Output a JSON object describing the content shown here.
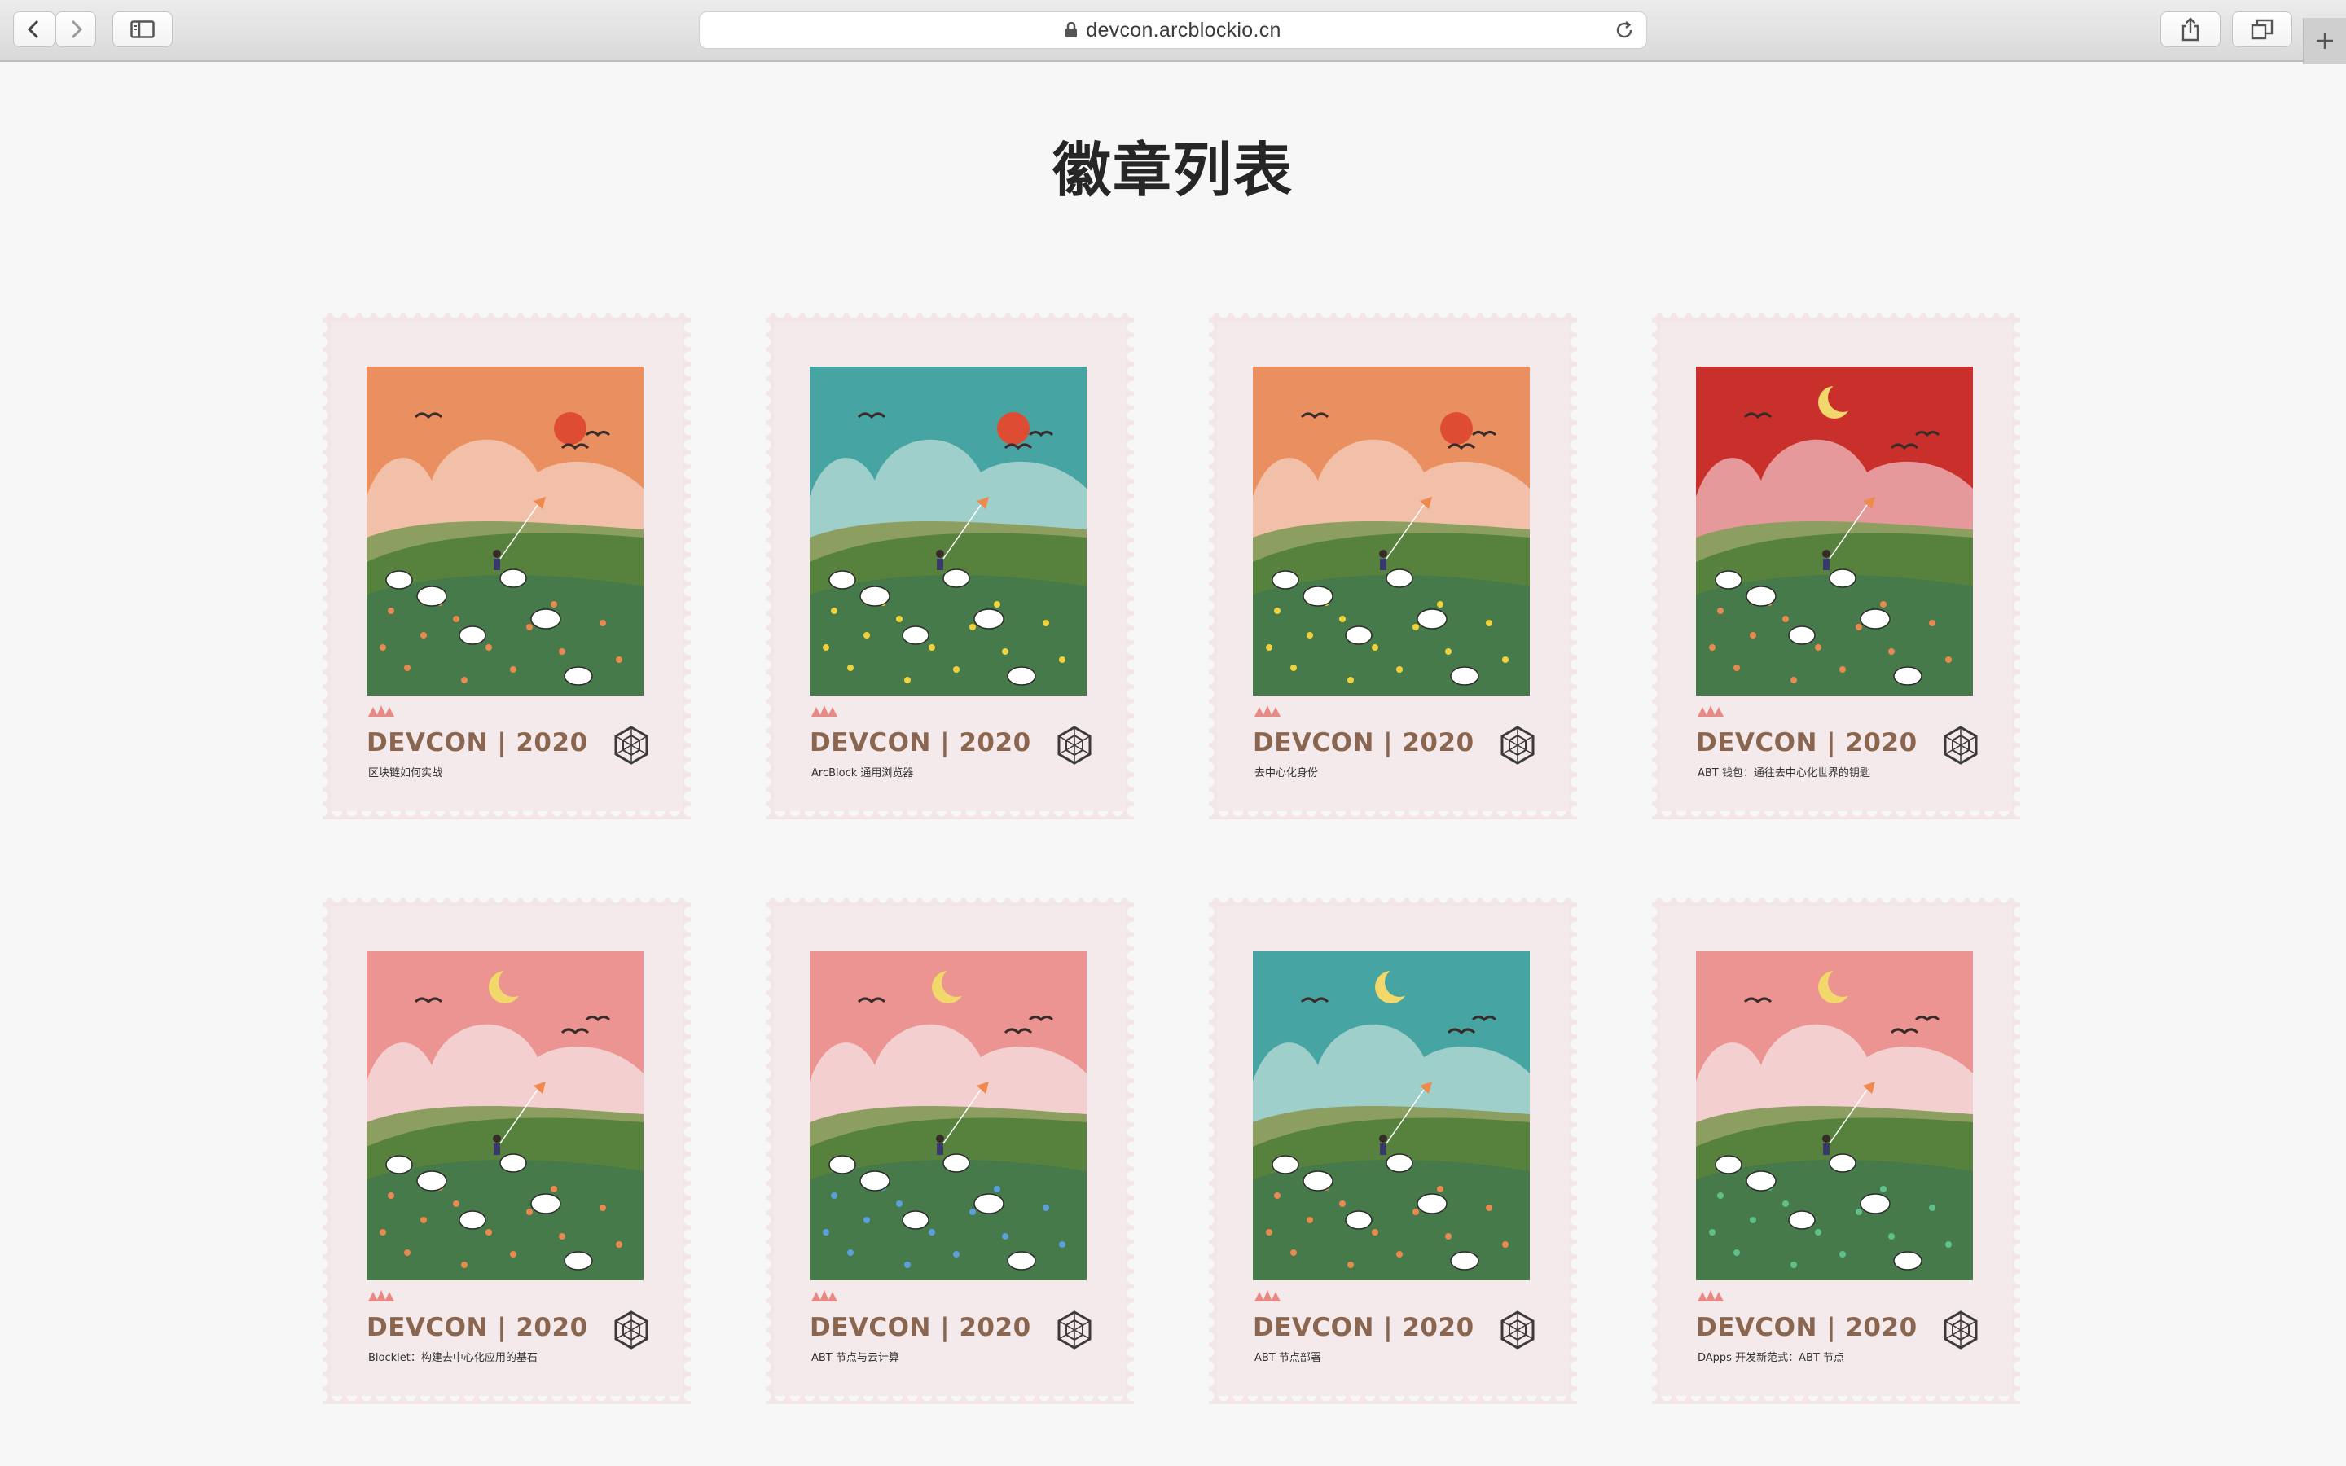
{
  "browser": {
    "url": "devcon.arcblockio.cn"
  },
  "page": {
    "title": "徽章列表"
  },
  "badges": [
    {
      "brand": "DEVCON | 2020",
      "subtitle": "区块链如何实战",
      "sky": "#ea8f5f",
      "cloud": "#f2c0a8",
      "celestial": "sun",
      "flowers": "#e8894f"
    },
    {
      "brand": "DEVCON | 2020",
      "subtitle": "ArcBlock 通用浏览器",
      "sky": "#46a5a3",
      "cloud": "#9fcfca",
      "celestial": "sun",
      "flowers": "#f0d23a"
    },
    {
      "brand": "DEVCON | 2020",
      "subtitle": "去中心化身份",
      "sky": "#ea8f5f",
      "cloud": "#f2c0a8",
      "celestial": "sun",
      "flowers": "#f0d23a"
    },
    {
      "brand": "DEVCON | 2020",
      "subtitle": "ABT 钱包：通往去中心化世界的钥匙",
      "sky": "#c9302c",
      "cloud": "#e6999a",
      "celestial": "moon",
      "flowers": "#e8894f"
    },
    {
      "brand": "DEVCON | 2020",
      "subtitle": "Blocklet：构建去中心化应用的基石",
      "sky": "#eb9492",
      "cloud": "#f3cfcf",
      "celestial": "moon",
      "flowers": "#e8894f"
    },
    {
      "brand": "DEVCON | 2020",
      "subtitle": "ABT 节点与云计算",
      "sky": "#eb9492",
      "cloud": "#f3cfcf",
      "celestial": "moon",
      "flowers": "#5b9fdc"
    },
    {
      "brand": "DEVCON | 2020",
      "subtitle": "ABT 节点部署",
      "sky": "#46a5a3",
      "cloud": "#9fcfca",
      "celestial": "moon",
      "flowers": "#e8894f"
    },
    {
      "brand": "DEVCON | 2020",
      "subtitle": "DApps 开发新范式：ABT 节点",
      "sky": "#eb9492",
      "cloud": "#f3cfcf",
      "celestial": "moon",
      "flowers": "#5fc08a"
    }
  ]
}
